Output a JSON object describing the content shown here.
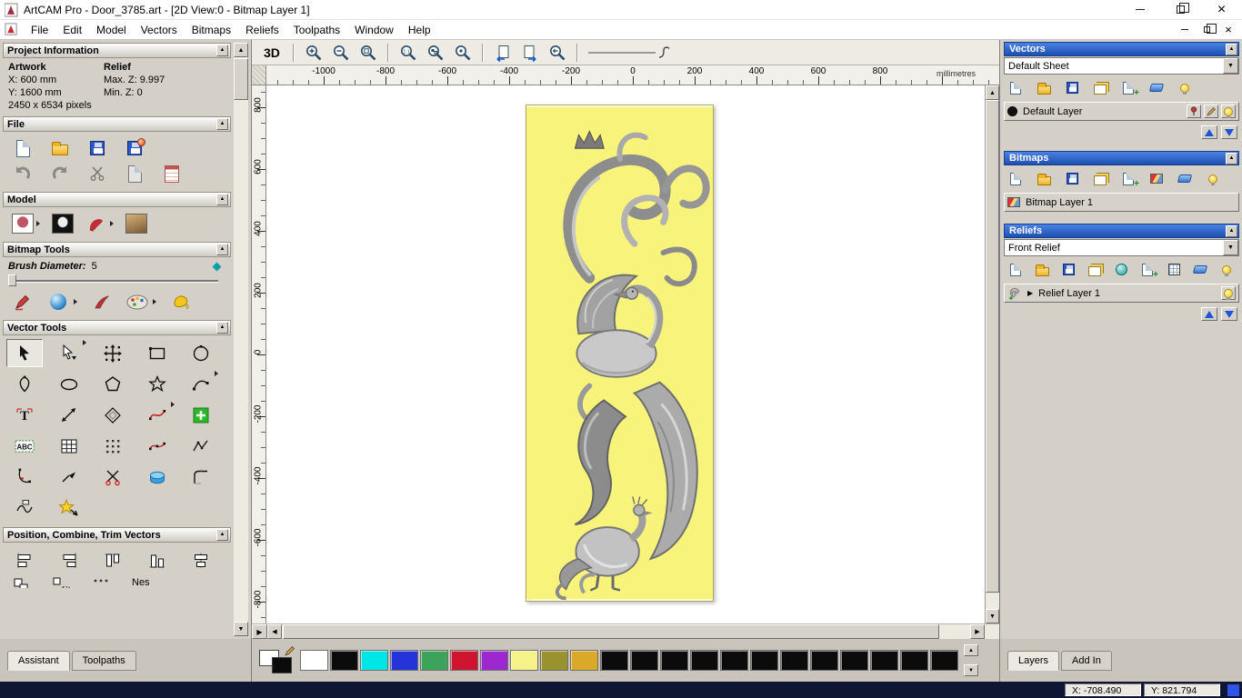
{
  "titlebar": {
    "title": "ArtCAM Pro - Door_3785.art - [2D View:0 - Bitmap Layer 1]"
  },
  "menubar": {
    "items": [
      "File",
      "Edit",
      "Model",
      "Vectors",
      "Bitmaps",
      "Reliefs",
      "Toolpaths",
      "Window",
      "Help"
    ]
  },
  "left_panel": {
    "project_information": {
      "header": "Project Information",
      "artwork_label": "Artwork",
      "relief_label": "Relief",
      "x": "X: 600 mm",
      "y": "Y: 1600 mm",
      "max_z": "Max. Z: 9.997",
      "min_z": "Min. Z: 0",
      "pixels": "2450 x 6534 pixels"
    },
    "file": {
      "header": "File"
    },
    "model": {
      "header": "Model"
    },
    "bitmap_tools": {
      "header": "Bitmap Tools",
      "brush_diameter_label": "Brush Diameter:",
      "brush_diameter_value": "5"
    },
    "vector_tools": {
      "header": "Vector Tools",
      "abc_label": "ABC"
    },
    "position_combine": {
      "header": "Position, Combine, Trim Vectors",
      "nesting_label": "Nes"
    },
    "tabs": {
      "assistant": "Assistant",
      "toolpaths": "Toolpaths"
    }
  },
  "toolbar": {
    "view_3d_label": "3D"
  },
  "rulers": {
    "h_ticks": [
      "-1000",
      "-800",
      "-600",
      "-400",
      "-200",
      "0",
      "200",
      "400",
      "600",
      "800"
    ],
    "v_ticks": [
      "800",
      "600",
      "400",
      "200",
      "0",
      "-200",
      "-400",
      "-600",
      "-800"
    ],
    "units_label": "millimetres"
  },
  "right_panel": {
    "vectors": {
      "header": "Vectors",
      "sheet_value": "Default Sheet",
      "layer_name": "Default Layer"
    },
    "bitmaps": {
      "header": "Bitmaps",
      "layer_name": "Bitmap Layer 1"
    },
    "reliefs": {
      "header": "Reliefs",
      "relief_value": "Front Relief",
      "layer_name": "Relief Layer 1"
    },
    "tabs": {
      "layers": "Layers",
      "add_in": "Add In"
    }
  },
  "palette": {
    "colors": [
      "#ffffff",
      "#0b0b0b",
      "#00e6e6",
      "#2534d8",
      "#3da35b",
      "#cf1430",
      "#9e28cf",
      "#f6f28a",
      "#99922f",
      "#dba929",
      "#0b0b0b",
      "#0b0b0b",
      "#0b0b0b",
      "#0b0b0b",
      "#0b0b0b",
      "#0b0b0b",
      "#0b0b0b",
      "#0b0b0b",
      "#0b0b0b",
      "#0b0b0b",
      "#0b0b0b",
      "#0b0b0b"
    ]
  },
  "statusbar": {
    "x_value": "X: -708.490",
    "y_value": "Y: 821.794"
  }
}
